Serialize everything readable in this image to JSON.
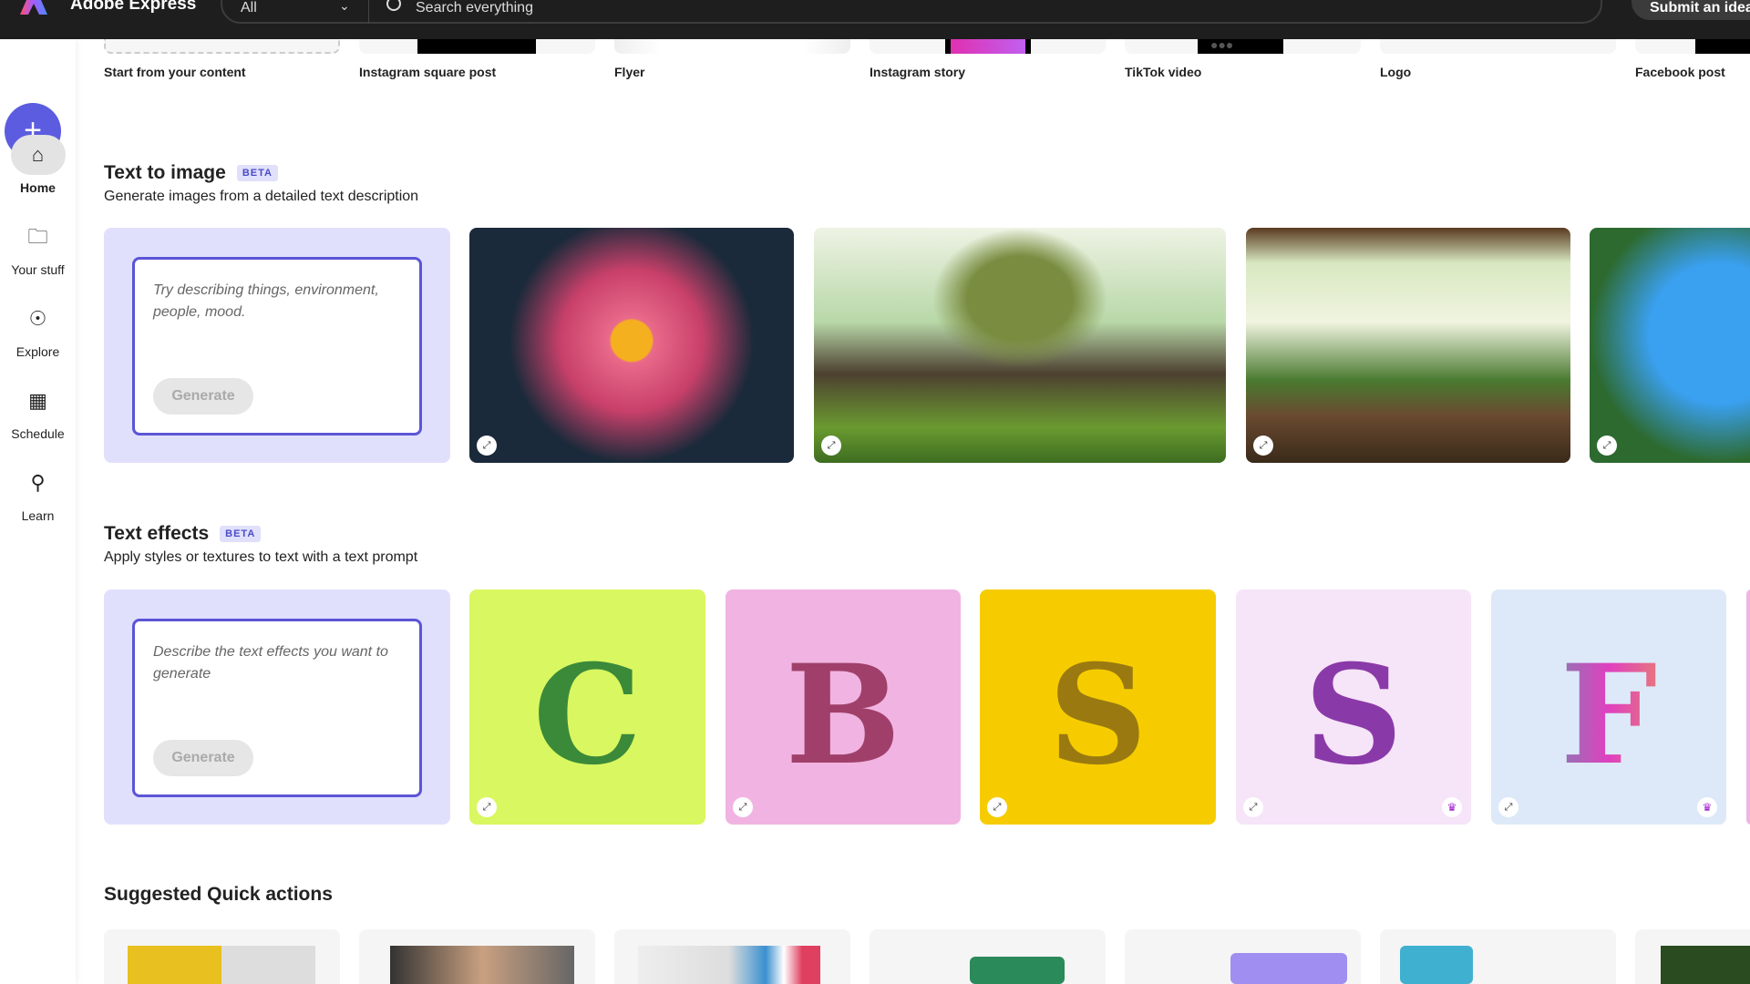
{
  "header": {
    "brand": "Adobe Express",
    "filter": "All",
    "search_placeholder": "Search everything",
    "submit": "Submit an idea"
  },
  "sidebar": {
    "items": [
      {
        "label": "Home",
        "icon": "home-icon"
      },
      {
        "label": "Your stuff",
        "icon": "folder-icon"
      },
      {
        "label": "Explore",
        "icon": "compass-icon"
      },
      {
        "label": "Schedule",
        "icon": "calendar-icon"
      },
      {
        "label": "Learn",
        "icon": "lightbulb-icon"
      }
    ]
  },
  "templates": [
    "Start from your content",
    "Instagram square post",
    "Flyer",
    "Instagram story",
    "TikTok video",
    "Logo",
    "Facebook post"
  ],
  "text_to_image": {
    "title": "Text to image",
    "badge": "BETA",
    "subtitle": "Generate images from a detailed text description",
    "placeholder": "Try describing things, environment, people, mood.",
    "generate": "Generate"
  },
  "text_effects": {
    "title": "Text effects",
    "badge": "BETA",
    "subtitle": "Apply styles or textures to text with a text prompt",
    "placeholder": "Describe the text effects you want to generate",
    "generate": "Generate",
    "letters": [
      "C",
      "B",
      "S",
      "S",
      "F"
    ]
  },
  "quick_actions": {
    "title": "Suggested Quick actions"
  },
  "colors": {
    "accent": "#5c5ce0",
    "prompt_bg": "#e1e0fc"
  }
}
